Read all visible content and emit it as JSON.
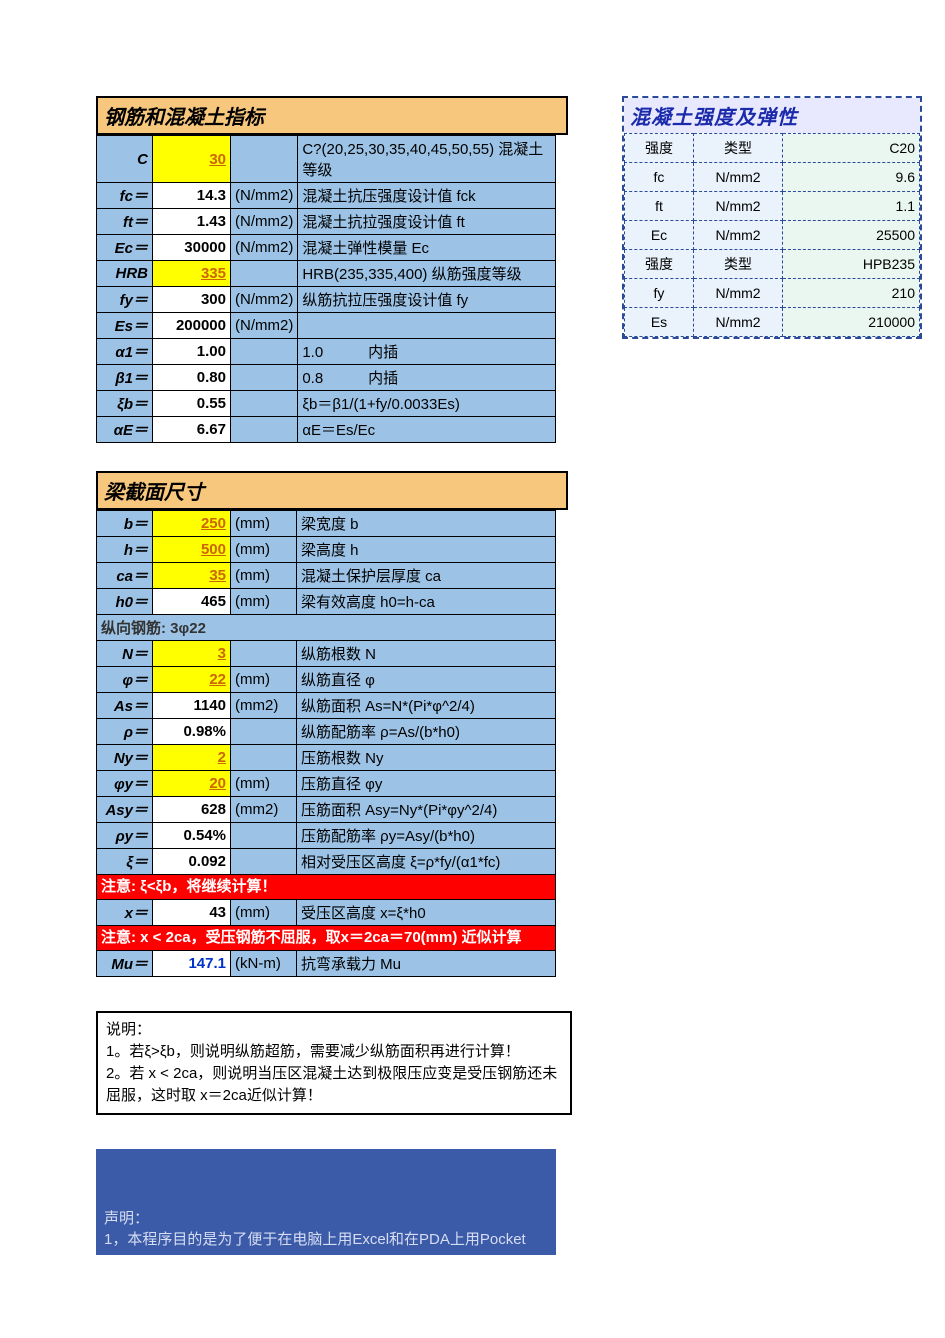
{
  "t1": {
    "title": "钢筋和混凝土指标",
    "rows": [
      {
        "l": "C",
        "v": "30",
        "vy": true,
        "u": "",
        "d": "C?(20,25,30,35,40,45,50,55) 混凝土等级"
      },
      {
        "l": "fc＝",
        "v": "14.3",
        "u": "(N/mm2)",
        "d": "混凝土抗压强度设计值 fck"
      },
      {
        "l": "ft＝",
        "v": "1.43",
        "u": "(N/mm2)",
        "d": "混凝土抗拉强度设计值 ft"
      },
      {
        "l": "Ec＝",
        "v": "30000",
        "u": "(N/mm2)",
        "d": "混凝土弹性模量 Ec"
      },
      {
        "l": "HRB",
        "v": "335",
        "vy": true,
        "u": "",
        "d": "HRB(235,335,400) 纵筋强度等级"
      },
      {
        "l": "fy＝",
        "v": "300",
        "u": "(N/mm2)",
        "d": "纵筋抗拉压强度设计值 fy"
      },
      {
        "l": "Es＝",
        "v": "200000",
        "u": "(N/mm2)",
        "d": ""
      },
      {
        "l": "α1＝",
        "v": "1.00",
        "u": "",
        "d": "1.0　　　内插"
      },
      {
        "l": "β1＝",
        "v": "0.80",
        "u": "",
        "d": "0.8　　　内插"
      },
      {
        "l": "ξb＝",
        "v": "0.55",
        "u": "",
        "d": "ξb＝β1/(1+fy/0.0033Es)"
      },
      {
        "l": "αE＝",
        "v": "6.67",
        "u": "",
        "d": "αE＝Es/Ec"
      }
    ]
  },
  "t2": {
    "title": "梁截面尺寸",
    "rows_a": [
      {
        "l": "b＝",
        "v": "250",
        "vy": true,
        "u": "(mm)",
        "d": "梁宽度 b"
      },
      {
        "l": "h＝",
        "v": "500",
        "vy": true,
        "u": "(mm)",
        "d": "梁高度 h"
      },
      {
        "l": "ca＝",
        "v": "35",
        "vy": true,
        "u": "(mm)",
        "d": "混凝土保护层厚度 ca"
      },
      {
        "l": "h0＝",
        "v": "465",
        "u": "(mm)",
        "d": "梁有效高度 h0=h-ca"
      }
    ],
    "bar_label": "纵向钢筋: 3φ22",
    "rows_b": [
      {
        "l": "N＝",
        "v": "3",
        "vy": true,
        "u": "",
        "d": "纵筋根数 N"
      },
      {
        "l": "φ＝",
        "v": "22",
        "vy": true,
        "u": "(mm)",
        "d": "纵筋直径 φ"
      },
      {
        "l": "As＝",
        "v": "1140",
        "u": "(mm2)",
        "d": "纵筋面积 As=N*(Pi*φ^2/4)"
      },
      {
        "l": "ρ＝",
        "v": "0.98%",
        "u": "",
        "d": "纵筋配筋率 ρ=As/(b*h0)"
      },
      {
        "l": "Ny＝",
        "v": "2",
        "vy": true,
        "u": "",
        "d": "压筋根数 Ny"
      },
      {
        "l": "φy＝",
        "v": "20",
        "vy": true,
        "u": "(mm)",
        "d": "压筋直径 φy"
      },
      {
        "l": "Asy＝",
        "v": "628",
        "u": "(mm2)",
        "d": "压筋面积 Asy=Ny*(Pi*φy^2/4)"
      },
      {
        "l": "ρy＝",
        "v": "0.54%",
        "u": "",
        "d": "压筋配筋率 ρy=Asy/(b*h0)"
      },
      {
        "l": "ξ＝",
        "v": "0.092",
        "u": "",
        "d": "相对受压区高度 ξ=ρ*fy/(α1*fc)"
      }
    ],
    "red1": "注意: ξ<ξb，将继续计算！",
    "rows_c": [
      {
        "l": "x＝",
        "v": "43",
        "u": "(mm)",
        "d": "受压区高度 x=ξ*h0"
      }
    ],
    "red2": "注意: x < 2ca，受压钢筋不屈服，取x＝2ca＝70(mm) 近似计算",
    "rows_d": [
      {
        "l": "Mu＝",
        "v": "147.1",
        "vb": true,
        "u": "(kN-m)",
        "d": "抗弯承载力 Mu"
      }
    ]
  },
  "side": {
    "title": "混凝土强度及弹性",
    "rows": [
      [
        "强度",
        "类型",
        "C20"
      ],
      [
        "fc",
        "N/mm2",
        "9.6"
      ],
      [
        "ft",
        "N/mm2",
        "1.1"
      ],
      [
        "Ec",
        "N/mm2",
        "25500"
      ],
      [
        "强度",
        "类型",
        "HPB235"
      ],
      [
        "fy",
        "N/mm2",
        "210"
      ],
      [
        "Es",
        "N/mm2",
        "210000"
      ]
    ]
  },
  "notes": {
    "title": "说明：",
    "l1": "1。若ξ>ξb，则说明纵筋超筋，需要减少纵筋面积再进行计算！",
    "l2": "2。若 x < 2ca，则说明当压区混凝土达到极限压应变是受压钢筋还未屈服，这时取 x＝2ca近似计算！"
  },
  "footer": {
    "title": "声明：",
    "l1": "1，本程序目的是为了便于在电脑上用Excel和在PDA上用Pocket"
  }
}
